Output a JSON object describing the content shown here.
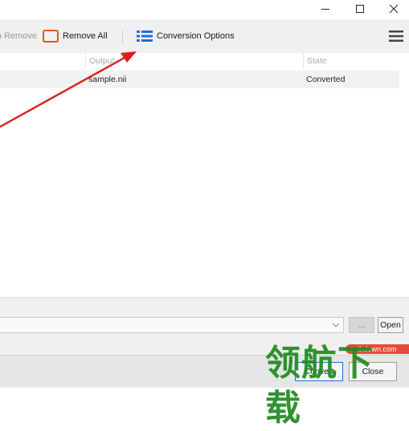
{
  "window": {
    "minimize_glyph": "—",
    "maximize_glyph": "☐",
    "close_glyph": "✕"
  },
  "toolbar": {
    "remove_label": "Remove",
    "remove_all_label": "Remove All",
    "conversion_options_label": "Conversion Options",
    "menu_icon": "hamburger-menu-icon"
  },
  "table": {
    "columns": [
      "Output",
      "State"
    ],
    "rows": [
      {
        "output": "sample.nii",
        "state": "Converted"
      }
    ]
  },
  "output_path": {
    "value": "",
    "browse_label": "...",
    "open_label": "Open"
  },
  "footer": {
    "convert_label": "Convert",
    "close_label": "Close"
  },
  "watermark": {
    "url": "lhdown.com",
    "text": "领航下载"
  },
  "colors": {
    "remove_all_icon": "#e05a1c",
    "conversion_icon": "#1e6fd9",
    "arrow": "#d81e1e",
    "watermark_green": "#1f8a1f"
  }
}
